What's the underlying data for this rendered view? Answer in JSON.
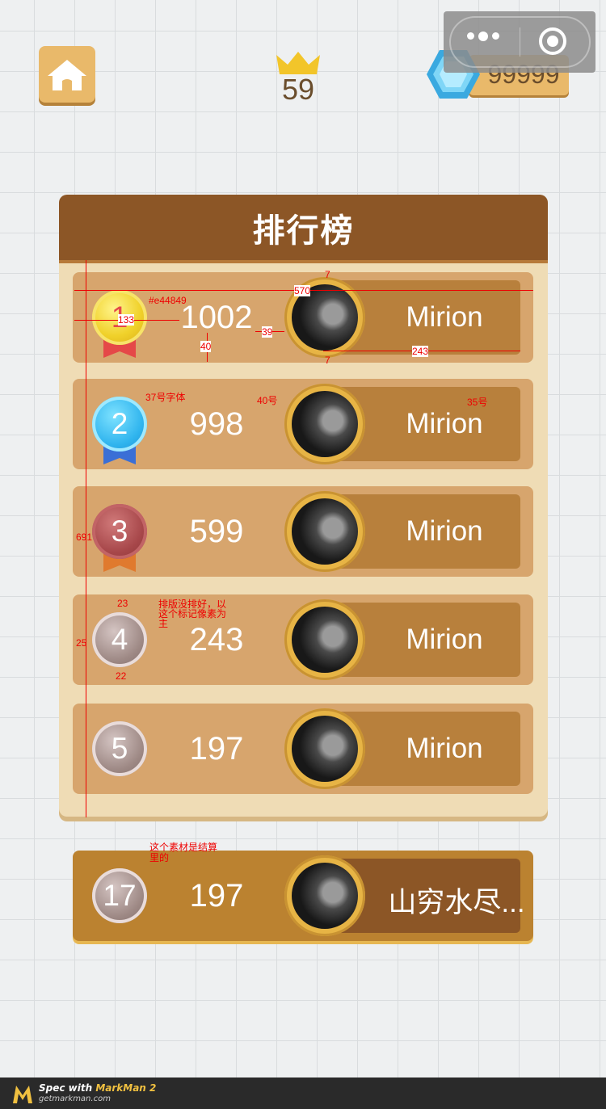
{
  "header": {
    "level": "59",
    "gems": "99999"
  },
  "board": {
    "title": "排行榜",
    "rows": [
      {
        "rank": "1",
        "score": "1002",
        "name": "Mirion",
        "medal": "gold"
      },
      {
        "rank": "2",
        "score": "998",
        "name": "Mirion",
        "medal": "blue"
      },
      {
        "rank": "3",
        "score": "599",
        "name": "Mirion",
        "medal": "bronze"
      },
      {
        "rank": "4",
        "score": "243",
        "name": "Mirion",
        "medal": "gray"
      },
      {
        "rank": "5",
        "score": "197",
        "name": "Mirion",
        "medal": "gray"
      }
    ]
  },
  "self_row": {
    "rank": "17",
    "score": "197",
    "name": "山穷水尽..."
  },
  "annotations": {
    "color_label": "#e44849",
    "d7a": "7",
    "d570": "570",
    "d133": "133",
    "d39": "39",
    "d40": "40",
    "d243": "243",
    "d7b": "7",
    "font37": "37号字体",
    "font40": "40号",
    "font35": "35号",
    "d691": "691",
    "d23": "23",
    "note_layout_1": "排版没排好，以",
    "note_layout_2": "这个标记像素为",
    "note_layout_3": "主",
    "d25": "25",
    "d22": "22",
    "note_material_1": "这个素材是结算",
    "note_material_2": "里的"
  },
  "footer": {
    "line1_prefix": "Spec with ",
    "line1_brand": "MarkMan 2",
    "line2": "getmarkman.com"
  },
  "colors": {
    "header_brown": "#8c5626",
    "board_bg": "#efdcb5",
    "row_bg": "#d7a56d",
    "self_row_bg": "#bb8230",
    "rank1_color": "#e44849"
  }
}
